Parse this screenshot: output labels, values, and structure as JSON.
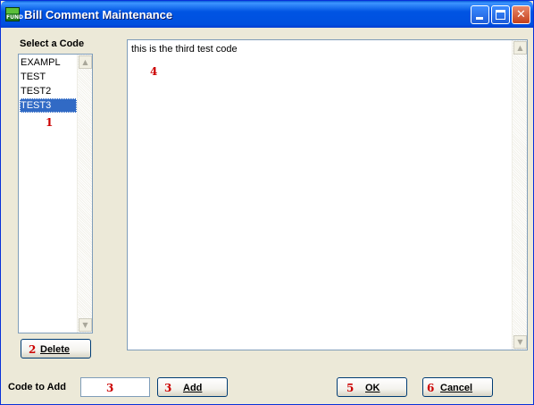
{
  "window": {
    "title": "Bill Comment Maintenance",
    "app_icon_text": "FUND"
  },
  "codes": {
    "heading": "Select a Code",
    "items": [
      "EXAMPL",
      "TEST",
      "TEST2",
      "TEST3"
    ],
    "selected": "TEST3",
    "callout": "1"
  },
  "comment": {
    "text": "this is the third test code",
    "callout": "4"
  },
  "buttons": {
    "delete": {
      "num": "2",
      "label": "Delete"
    },
    "add": {
      "num": "3",
      "label": "Add"
    },
    "ok": {
      "num": "5",
      "label": "OK"
    },
    "cancel": {
      "num": "6",
      "label": "Cancel"
    }
  },
  "code_to_add": {
    "label": "Code to Add",
    "value": "",
    "callout": "3"
  },
  "colors": {
    "titlebar": "#0054e3",
    "selection": "#316ac5",
    "callout": "#cc0000"
  }
}
